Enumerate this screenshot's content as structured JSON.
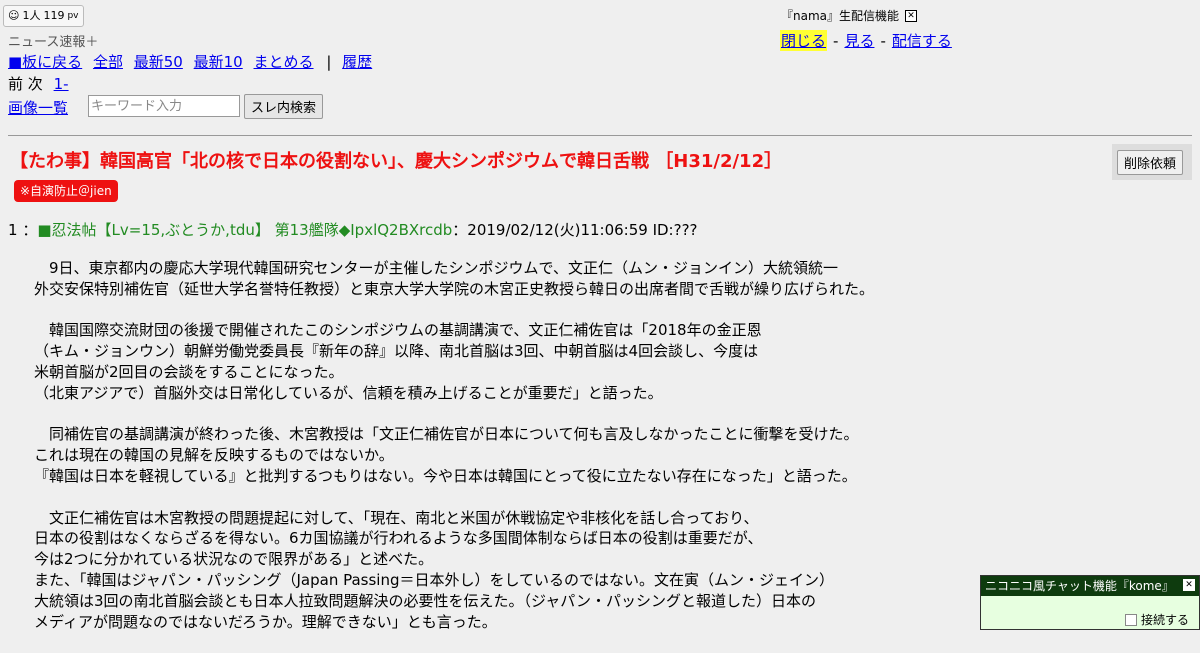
{
  "counter": {
    "users": "1人",
    "pv_value": "119",
    "pv_unit": "pv"
  },
  "brand": "ニュース速報＋",
  "nav": {
    "back": "■板に戻る",
    "all": "全部",
    "latest50": "最新50",
    "latest10": "最新10",
    "summarize": "まとめる",
    "sep": "|",
    "history": "履歴"
  },
  "paging": {
    "prev": "前",
    "next": "次",
    "range": "1-"
  },
  "images": "画像一覧",
  "search": {
    "placeholder": "キーワード入力",
    "button": "スレ内検索"
  },
  "nama": {
    "title": "『nama』生配信機能",
    "close": "閉じる",
    "dash1": "-",
    "watch": "見る",
    "dash2": "-",
    "broadcast": "配信する"
  },
  "thread": {
    "title": "【たわ事】韓国高官「北の核で日本の役割ない」、慶大シンポジウムで韓日舌戦 ［H31/2/12］",
    "delete_button": "削除依頼",
    "badge": "※自演防止＠jien"
  },
  "post": {
    "number": "1",
    "colon": "：",
    "name": "■忍法帖【Lv=15,ぶとうか,tdu】 第13艦隊◆IpxlQ2BXrcdb",
    "meta": "：2019/02/12(火)11:06:59 ID:???",
    "paragraphs": [
      "　9日、東京都内の慶応大学現代韓国研究センターが主催したシンポジウムで、文正仁（ムン・ジョンイン）大統領統一\n外交安保特別補佐官（延世大学名誉特任教授）と東京大学大学院の木宮正史教授ら韓日の出席者間で舌戦が繰り広げられた。",
      "　韓国国際交流財団の後援で開催されたこのシンポジウムの基調講演で、文正仁補佐官は「2018年の金正恩\n（キム・ジョンウン）朝鮮労働党委員長『新年の辞』以降、南北首脳は3回、中朝首脳は4回会談し、今度は\n米朝首脳が2回目の会談をすることになった。\n（北東アジアで）首脳外交は日常化しているが、信頼を積み上げることが重要だ」と語った。",
      "　同補佐官の基調講演が終わった後、木宮教授は「文正仁補佐官が日本について何も言及しなかったことに衝撃を受けた。\nこれは現在の韓国の見解を反映するものではないか。\n『韓国は日本を軽視している』と批判するつもりはない。今や日本は韓国にとって役に立たない存在になった」と語った。",
      "　文正仁補佐官は木宮教授の問題提起に対して、「現在、南北と米国が休戦協定や非核化を話し合っており、\n日本の役割はなくならざるを得ない。6カ国協議が行われるような多国間体制ならば日本の役割は重要だが、\n今は2つに分かれている状況なので限界がある」と述べた。\nまた、「韓国はジャパン・パッシング（Japan Passing＝日本外し）をしているのではない。文在寅（ムン・ジェイン）\n大統領は3回の南北首脳会談とも日本人拉致問題解決の必要性を伝えた。（ジャパン・パッシングと報道した）日本の\nメディアが問題なのではないだろうか。理解できない」とも言った。"
    ]
  },
  "chat": {
    "title": "ニコニコ風チャット機能『kome』",
    "connect": "接続する"
  }
}
